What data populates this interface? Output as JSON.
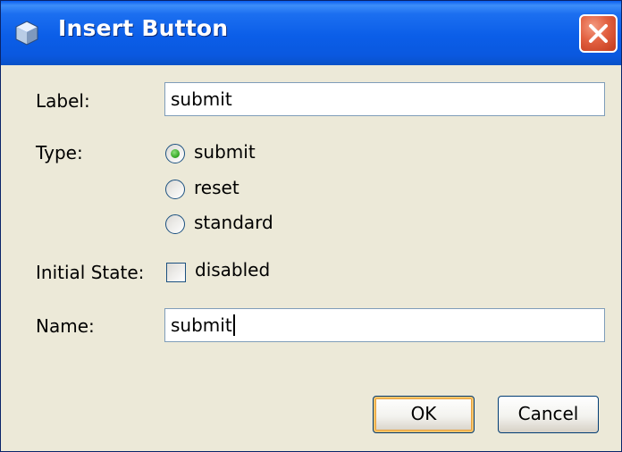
{
  "window": {
    "title": "Insert Button",
    "close_label": "close"
  },
  "form": {
    "label_caption": "Label:",
    "label_value": "submit",
    "type_caption": "Type:",
    "type_options": [
      {
        "label": "submit",
        "selected": true
      },
      {
        "label": "reset",
        "selected": false
      },
      {
        "label": "standard",
        "selected": false
      }
    ],
    "initial_state_caption": "Initial State:",
    "disabled_label": "disabled",
    "disabled_checked": false,
    "name_caption": "Name:",
    "name_value": "submit"
  },
  "buttons": {
    "ok_label": "OK",
    "cancel_label": "Cancel"
  },
  "colors": {
    "titlebar": "#0a5ef0",
    "dialog_bg": "#ece9d8",
    "close": "#e26040",
    "radio_selected": "#2fa320"
  },
  "icons": {
    "title": "cube-icon",
    "close": "close-icon"
  }
}
